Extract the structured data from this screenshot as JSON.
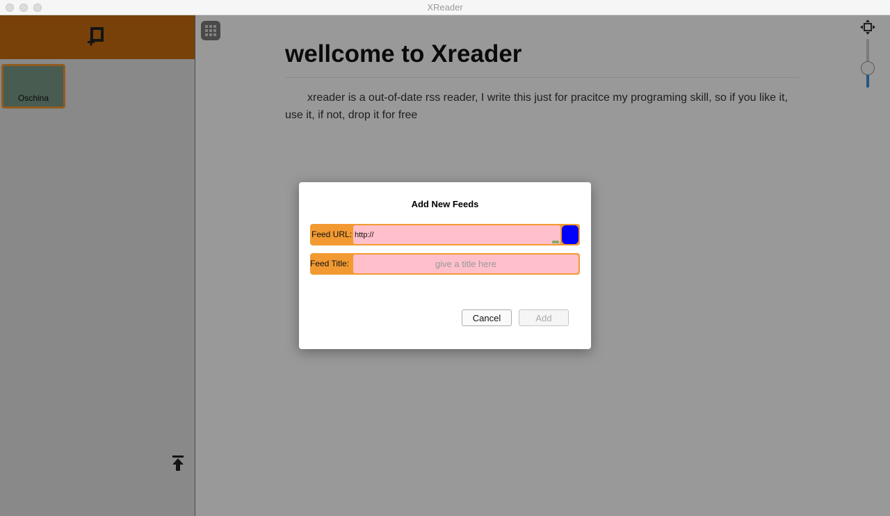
{
  "window": {
    "title": "XReader"
  },
  "sidebar": {
    "add_feed_icon": "add-feed-icon",
    "feeds": [
      {
        "label": "Oschina"
      }
    ],
    "upload_icon": "upload-icon"
  },
  "main": {
    "grid_icon": "grid-icon",
    "article": {
      "title": "wellcome to Xreader",
      "body": "xreader is a out-of-date rss reader, I write this just for pracitce my programing skill, so if you like it, use it, if not, drop it for free"
    },
    "zoom_icon": "move-icon"
  },
  "dialog": {
    "title": "Add New Feeds",
    "url_label": "Feed URL:",
    "url_value": "http://",
    "title_label": "Feed Title:",
    "title_placeholder": "give a title here",
    "cancel_label": "Cancel",
    "add_label": "Add"
  },
  "colors": {
    "sidebar_header": "#c86d0f",
    "accent_orange": "#f29a31",
    "input_pink": "#ffc0cb",
    "go_button": "#0000ff",
    "feed_tile": "#7a9988"
  }
}
